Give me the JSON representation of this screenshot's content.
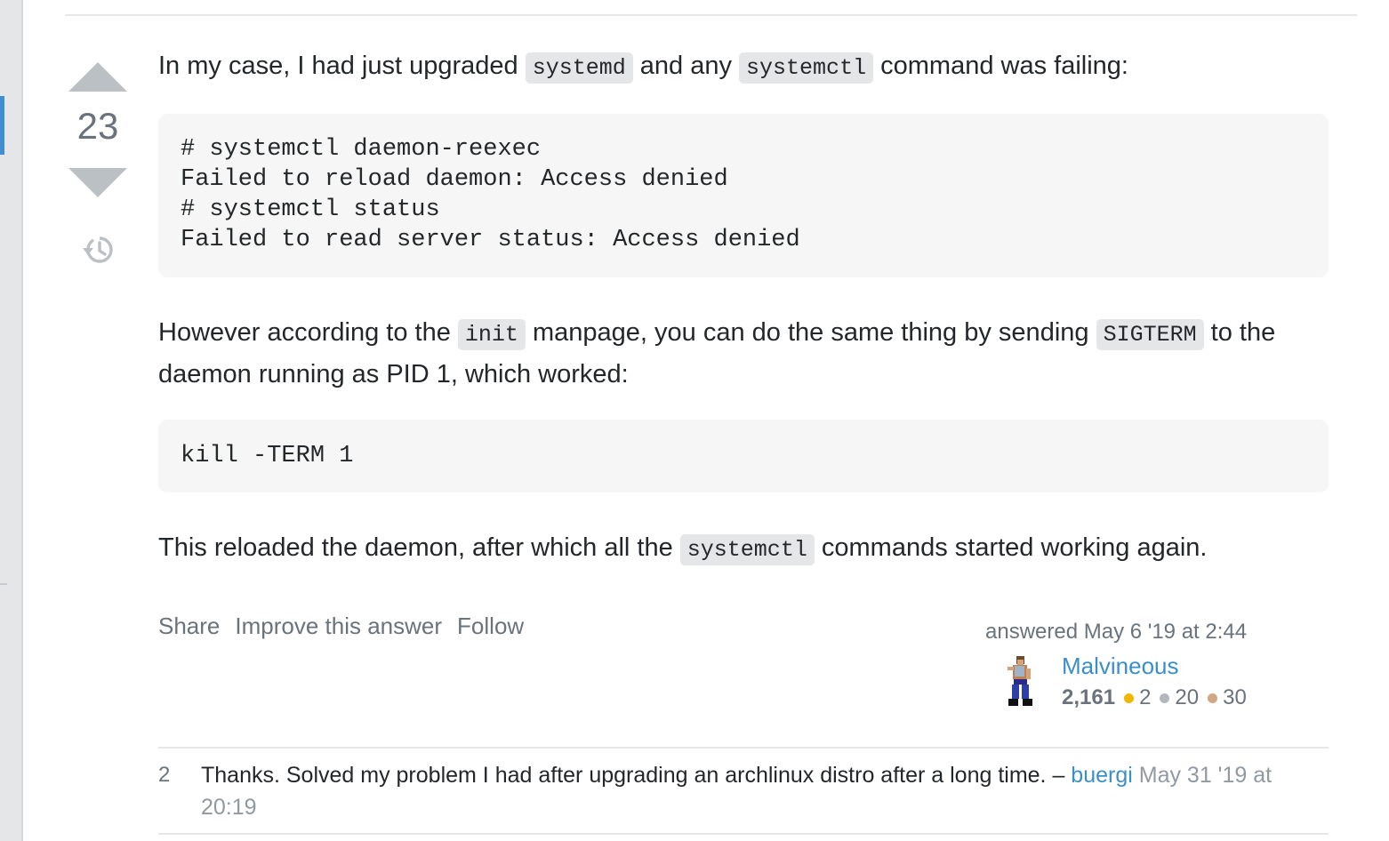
{
  "vote": {
    "count": "23"
  },
  "post": {
    "p1": {
      "t1": "In my case, I had just upgraded ",
      "c1": "systemd",
      "t2": " and any ",
      "c2": "systemctl",
      "t3": " command was failing:"
    },
    "code_block_1": [
      "# systemctl daemon-reexec",
      "Failed to reload daemon: Access denied",
      "# systemctl status",
      "Failed to read server status: Access denied"
    ],
    "p2": {
      "t1": "However according to the ",
      "c1": "init",
      "t2": " manpage, you can do the same thing by sending ",
      "c2": "SIGTERM",
      "t3": " to the daemon running as PID 1, which worked:"
    },
    "code_block_2": [
      "kill -TERM 1"
    ],
    "p3": {
      "t1": "This reloaded the daemon, after which all the ",
      "c1": "systemctl",
      "t2": " commands started working again."
    }
  },
  "post_menu": {
    "share": "Share",
    "improve": "Improve this answer",
    "follow": "Follow"
  },
  "user_info": {
    "action_time": "answered May 6 '19 at 2:44",
    "name": "Malvineous",
    "reputation": "2,161",
    "badges": {
      "gold": "2",
      "silver": "20",
      "bronze": "30"
    },
    "badge_colors": {
      "gold": "#f1b600",
      "silver": "#b4b8bc",
      "bronze": "#d1a684"
    }
  },
  "comment": {
    "score": "2",
    "text": "Thanks. Solved my problem I had after upgrading an archlinux distro after a long time. – ",
    "user": "buergi",
    "date": " May 31 '19 at 20:19"
  },
  "colors": {
    "accent": "#3d8fd1",
    "link": "#3b8fc9",
    "muted": "#6a737c",
    "code_bg": "#f6f6f6",
    "inline_code_bg": "#e4e6e8"
  },
  "icons": {
    "upvote": "triangle-up",
    "downvote": "triangle-down",
    "history": "history-clock"
  }
}
